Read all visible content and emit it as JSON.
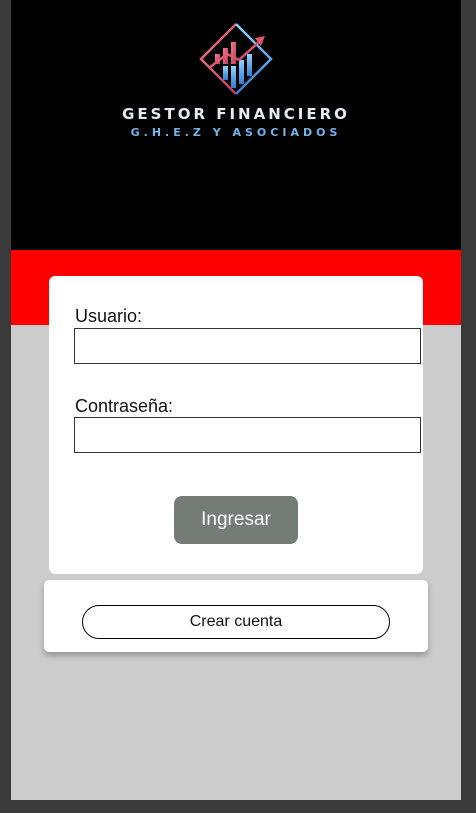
{
  "brand": {
    "title": "GESTOR FINANCIERO",
    "subtitle": "G.H.E.Z Y ASOCIADOS",
    "logo_icon": "rising-bar-chart-diamond-icon"
  },
  "login": {
    "username_label": "Usuario:",
    "username_value": "",
    "password_label": "Contraseña:",
    "password_value": "",
    "submit_label": "Ingresar"
  },
  "signup": {
    "button_label": "Crear cuenta"
  },
  "colors": {
    "header_background": "#000000",
    "accent_band": "#ff0000",
    "page_background": "#cccccc",
    "submit_button": "#757b76",
    "logo_pink": "#e0566f",
    "logo_blue": "#4aa8e8"
  }
}
